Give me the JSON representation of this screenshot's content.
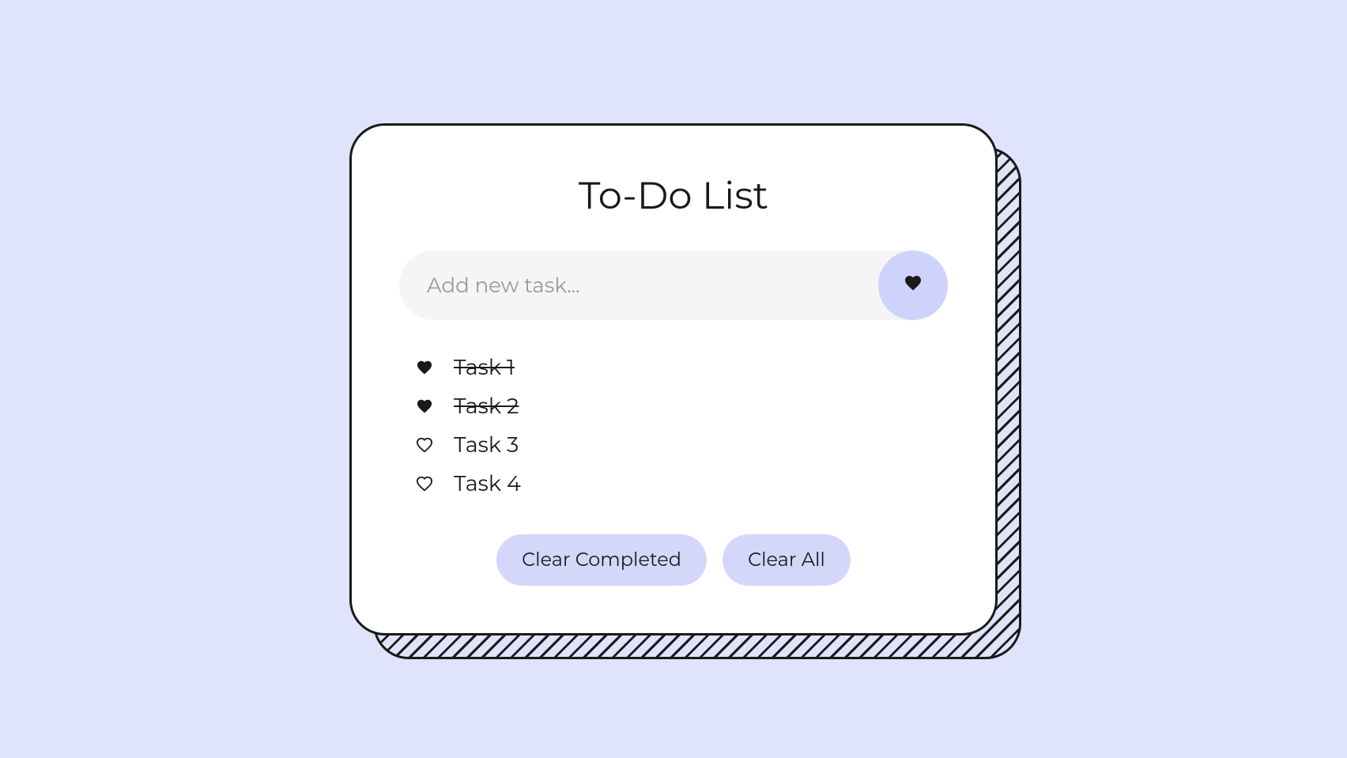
{
  "title": "To-Do List",
  "input": {
    "placeholder": "Add new task...",
    "value": ""
  },
  "tasks": [
    {
      "label": "Task 1",
      "completed": true
    },
    {
      "label": "Task 2",
      "completed": true
    },
    {
      "label": "Task 3",
      "completed": false
    },
    {
      "label": "Task 4",
      "completed": false
    }
  ],
  "buttons": {
    "clear_completed": "Clear Completed",
    "clear_all": "Clear All"
  },
  "colors": {
    "background": "#dfe3fb",
    "card": "#ffffff",
    "border": "#1a1a1a",
    "input_bg": "#f5f5f5",
    "accent": "#cdd3fa",
    "button_bg": "#d3d8fa"
  }
}
